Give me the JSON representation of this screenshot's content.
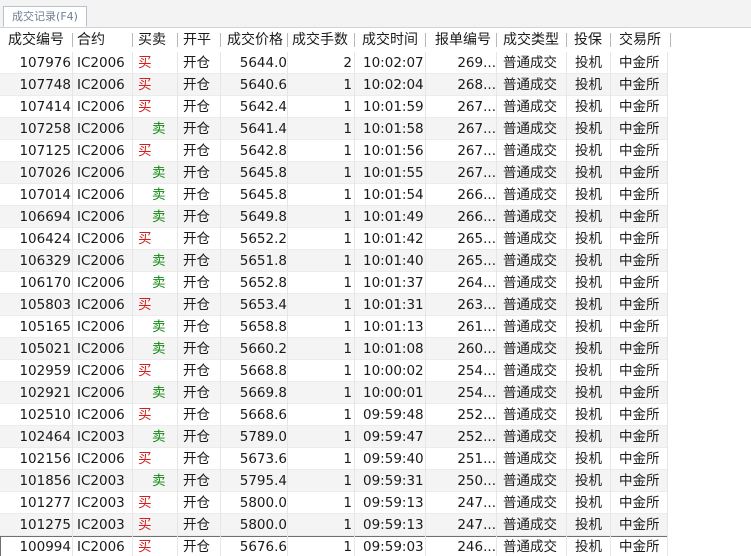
{
  "tab": {
    "label": "成交记录(F4)"
  },
  "columns": [
    "成交编号",
    "合约",
    "买卖",
    "开平",
    "成交价格",
    "成交手数",
    "成交时间",
    "报单编号",
    "成交类型",
    "投保",
    "交易所"
  ],
  "side_colors": {
    "buy": "#d42020",
    "sell": "#118a11"
  },
  "rows": [
    {
      "id": "107976",
      "contract": "IC2006",
      "side": "买",
      "side_type": "buy",
      "offset": "开仓",
      "price": "5644.0",
      "qty": "2",
      "time": "10:02:07",
      "order": "269...",
      "type": "普通成交",
      "hedge": "投机",
      "exchange": "中金所"
    },
    {
      "id": "107748",
      "contract": "IC2006",
      "side": "买",
      "side_type": "buy",
      "offset": "开仓",
      "price": "5640.6",
      "qty": "1",
      "time": "10:02:04",
      "order": "268...",
      "type": "普通成交",
      "hedge": "投机",
      "exchange": "中金所"
    },
    {
      "id": "107414",
      "contract": "IC2006",
      "side": "买",
      "side_type": "buy",
      "offset": "开仓",
      "price": "5642.4",
      "qty": "1",
      "time": "10:01:59",
      "order": "267...",
      "type": "普通成交",
      "hedge": "投机",
      "exchange": "中金所"
    },
    {
      "id": "107258",
      "contract": "IC2006",
      "side": "卖",
      "side_type": "sell",
      "offset": "开仓",
      "price": "5641.4",
      "qty": "1",
      "time": "10:01:58",
      "order": "267...",
      "type": "普通成交",
      "hedge": "投机",
      "exchange": "中金所"
    },
    {
      "id": "107125",
      "contract": "IC2006",
      "side": "买",
      "side_type": "buy",
      "offset": "开仓",
      "price": "5642.8",
      "qty": "1",
      "time": "10:01:56",
      "order": "267...",
      "type": "普通成交",
      "hedge": "投机",
      "exchange": "中金所"
    },
    {
      "id": "107026",
      "contract": "IC2006",
      "side": "卖",
      "side_type": "sell",
      "offset": "开仓",
      "price": "5645.8",
      "qty": "1",
      "time": "10:01:55",
      "order": "267...",
      "type": "普通成交",
      "hedge": "投机",
      "exchange": "中金所"
    },
    {
      "id": "107014",
      "contract": "IC2006",
      "side": "卖",
      "side_type": "sell",
      "offset": "开仓",
      "price": "5645.8",
      "qty": "1",
      "time": "10:01:54",
      "order": "266...",
      "type": "普通成交",
      "hedge": "投机",
      "exchange": "中金所"
    },
    {
      "id": "106694",
      "contract": "IC2006",
      "side": "卖",
      "side_type": "sell",
      "offset": "开仓",
      "price": "5649.8",
      "qty": "1",
      "time": "10:01:49",
      "order": "266...",
      "type": "普通成交",
      "hedge": "投机",
      "exchange": "中金所"
    },
    {
      "id": "106424",
      "contract": "IC2006",
      "side": "买",
      "side_type": "buy",
      "offset": "开仓",
      "price": "5652.2",
      "qty": "1",
      "time": "10:01:42",
      "order": "265...",
      "type": "普通成交",
      "hedge": "投机",
      "exchange": "中金所"
    },
    {
      "id": "106329",
      "contract": "IC2006",
      "side": "卖",
      "side_type": "sell",
      "offset": "开仓",
      "price": "5651.8",
      "qty": "1",
      "time": "10:01:40",
      "order": "265...",
      "type": "普通成交",
      "hedge": "投机",
      "exchange": "中金所"
    },
    {
      "id": "106170",
      "contract": "IC2006",
      "side": "卖",
      "side_type": "sell",
      "offset": "开仓",
      "price": "5652.8",
      "qty": "1",
      "time": "10:01:37",
      "order": "264...",
      "type": "普通成交",
      "hedge": "投机",
      "exchange": "中金所"
    },
    {
      "id": "105803",
      "contract": "IC2006",
      "side": "买",
      "side_type": "buy",
      "offset": "开仓",
      "price": "5653.4",
      "qty": "1",
      "time": "10:01:31",
      "order": "263...",
      "type": "普通成交",
      "hedge": "投机",
      "exchange": "中金所"
    },
    {
      "id": "105165",
      "contract": "IC2006",
      "side": "卖",
      "side_type": "sell",
      "offset": "开仓",
      "price": "5658.8",
      "qty": "1",
      "time": "10:01:13",
      "order": "261...",
      "type": "普通成交",
      "hedge": "投机",
      "exchange": "中金所"
    },
    {
      "id": "105021",
      "contract": "IC2006",
      "side": "卖",
      "side_type": "sell",
      "offset": "开仓",
      "price": "5660.2",
      "qty": "1",
      "time": "10:01:08",
      "order": "260...",
      "type": "普通成交",
      "hedge": "投机",
      "exchange": "中金所"
    },
    {
      "id": "102959",
      "contract": "IC2006",
      "side": "买",
      "side_type": "buy",
      "offset": "开仓",
      "price": "5668.8",
      "qty": "1",
      "time": "10:00:02",
      "order": "254...",
      "type": "普通成交",
      "hedge": "投机",
      "exchange": "中金所"
    },
    {
      "id": "102921",
      "contract": "IC2006",
      "side": "卖",
      "side_type": "sell",
      "offset": "开仓",
      "price": "5669.8",
      "qty": "1",
      "time": "10:00:01",
      "order": "254...",
      "type": "普通成交",
      "hedge": "投机",
      "exchange": "中金所"
    },
    {
      "id": "102510",
      "contract": "IC2006",
      "side": "买",
      "side_type": "buy",
      "offset": "开仓",
      "price": "5668.6",
      "qty": "1",
      "time": "09:59:48",
      "order": "252...",
      "type": "普通成交",
      "hedge": "投机",
      "exchange": "中金所"
    },
    {
      "id": "102464",
      "contract": "IC2003",
      "side": "卖",
      "side_type": "sell",
      "offset": "开仓",
      "price": "5789.0",
      "qty": "1",
      "time": "09:59:47",
      "order": "252...",
      "type": "普通成交",
      "hedge": "投机",
      "exchange": "中金所"
    },
    {
      "id": "102156",
      "contract": "IC2006",
      "side": "买",
      "side_type": "buy",
      "offset": "开仓",
      "price": "5673.6",
      "qty": "1",
      "time": "09:59:40",
      "order": "251...",
      "type": "普通成交",
      "hedge": "投机",
      "exchange": "中金所"
    },
    {
      "id": "101856",
      "contract": "IC2003",
      "side": "卖",
      "side_type": "sell",
      "offset": "开仓",
      "price": "5795.4",
      "qty": "1",
      "time": "09:59:31",
      "order": "250...",
      "type": "普通成交",
      "hedge": "投机",
      "exchange": "中金所"
    },
    {
      "id": "101277",
      "contract": "IC2003",
      "side": "买",
      "side_type": "buy",
      "offset": "开仓",
      "price": "5800.0",
      "qty": "1",
      "time": "09:59:13",
      "order": "247...",
      "type": "普通成交",
      "hedge": "投机",
      "exchange": "中金所"
    },
    {
      "id": "101275",
      "contract": "IC2003",
      "side": "买",
      "side_type": "buy",
      "offset": "开仓",
      "price": "5800.0",
      "qty": "1",
      "time": "09:59:13",
      "order": "247...",
      "type": "普通成交",
      "hedge": "投机",
      "exchange": "中金所"
    },
    {
      "id": "100994",
      "contract": "IC2006",
      "side": "买",
      "side_type": "buy",
      "offset": "开仓",
      "price": "5676.6",
      "qty": "1",
      "time": "09:59:03",
      "order": "246...",
      "type": "普通成交",
      "hedge": "投机",
      "exchange": "中金所"
    }
  ]
}
